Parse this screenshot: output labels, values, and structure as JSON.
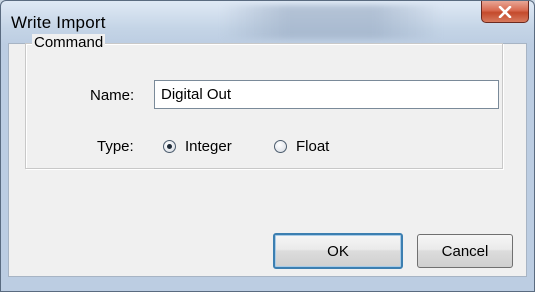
{
  "window": {
    "title": "Write Import",
    "close_glyph": "X"
  },
  "group": {
    "label": "Command"
  },
  "name_field": {
    "label": "Name:",
    "value": "Digital Out"
  },
  "type_field": {
    "label": "Type:",
    "options": [
      {
        "label": "Integer",
        "selected": true
      },
      {
        "label": "Float",
        "selected": false
      }
    ]
  },
  "buttons": {
    "ok": "OK",
    "cancel": "Cancel"
  },
  "icons": {
    "close": "close-icon",
    "radio": "radio-button"
  },
  "colors": {
    "titlebar": "#c4d4e6",
    "close_button": "#c44a2c",
    "dialog_background": "#f0f0f0",
    "default_button_border": "#3c7fb1"
  }
}
